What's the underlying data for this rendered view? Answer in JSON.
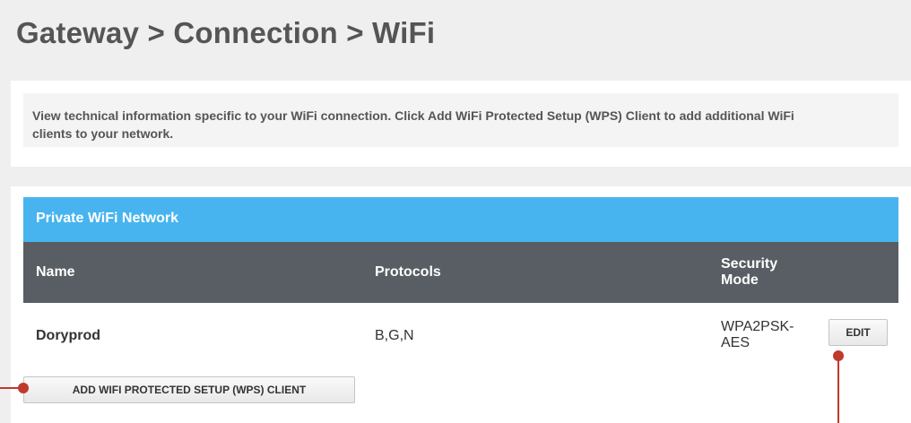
{
  "breadcrumb": {
    "title": "Gateway > Connection > WiFi"
  },
  "intro": {
    "text": "View technical information specific to your WiFi connection. Click Add WiFi Protected Setup (WPS) Client to add additional WiFi clients to your network."
  },
  "network": {
    "title": "Private WiFi Network",
    "columns": {
      "name": "Name",
      "protocols": "Protocols",
      "security": "Security Mode"
    },
    "rows": [
      {
        "name": "Doryprod",
        "protocols": "B,G,N",
        "security": "WPA2PSK-AES",
        "edit_label": "EDIT"
      }
    ],
    "wps_button_label": "ADD WIFI PROTECTED SETUP (WPS) CLIENT"
  },
  "colors": {
    "network_header": "#47b4ef",
    "columns_header": "#595e64",
    "callout": "#c0392b",
    "page_background": "#efefef"
  }
}
